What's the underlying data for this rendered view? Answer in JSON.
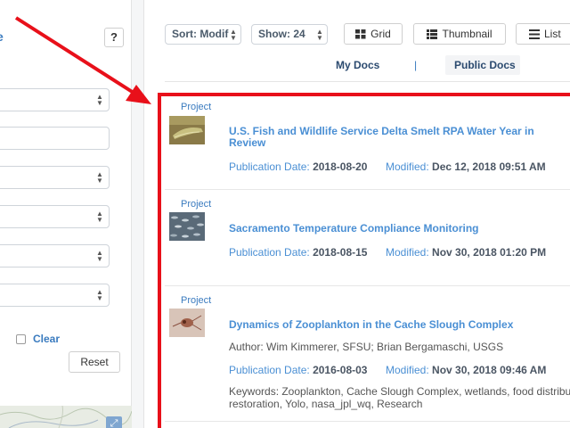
{
  "filters": {
    "help_label": "?",
    "clear_label": "Clear",
    "reset_label": "Reset",
    "edge_char": "e"
  },
  "toolbar": {
    "sort_value": "Sort: Modif",
    "show_value": "Show: 24",
    "grid_label": "Grid",
    "thumbnail_label": "Thumbnail",
    "list_label": "List"
  },
  "tabs": {
    "my_docs": "My Docs",
    "separator": "|",
    "public_docs": "Public Docs",
    "active": "Public Docs"
  },
  "results": [
    {
      "type": "Project",
      "title": "U.S. Fish and Wildlife Service Delta Smelt RPA Water Year in Review",
      "pub_label": "Publication Date:",
      "pub_date": "2018-08-20",
      "mod_label": "Modified:",
      "modified": "Dec 12, 2018 09:51 AM"
    },
    {
      "type": "Project",
      "title": "Sacramento Temperature Compliance Monitoring",
      "pub_label": "Publication Date:",
      "pub_date": "2018-08-15",
      "mod_label": "Modified:",
      "modified": "Nov 30, 2018 01:20 PM"
    },
    {
      "type": "Project",
      "title": "Dynamics of Zooplankton in the Cache Slough Complex",
      "author": "Author: Wim Kimmerer, SFSU; Brian Bergamaschi, USGS",
      "pub_label": "Publication Date:",
      "pub_date": "2016-08-03",
      "mod_label": "Modified:",
      "modified": "Nov 30, 2018 09:46 AM",
      "keywords_line1": "Keywords: Zooplankton, Cache Slough Complex, wetlands, food distribu",
      "keywords_line2": "restoration, Yolo, nasa_jpl_wq, Research"
    }
  ],
  "colors": {
    "highlight": "#e8101a",
    "link": "#4a8fd4",
    "tab_text": "#2b4a6f"
  }
}
